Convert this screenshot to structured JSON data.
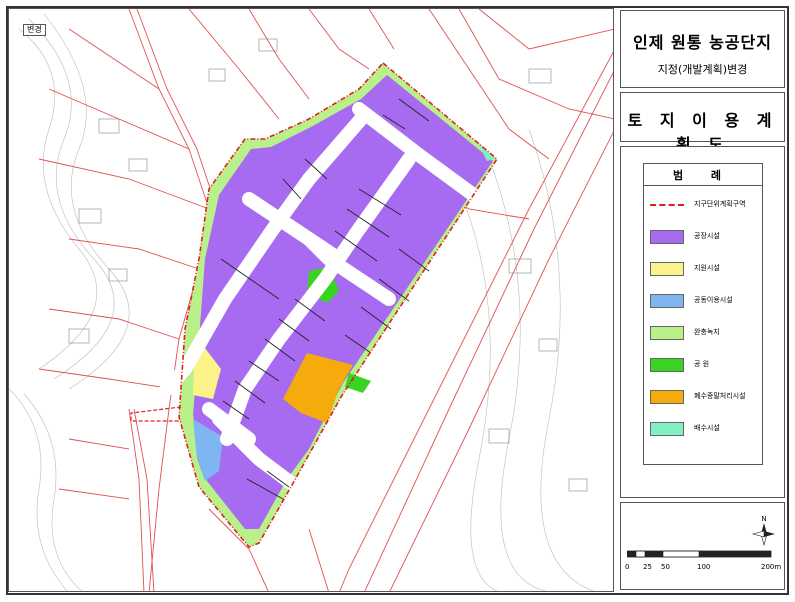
{
  "map": {
    "corner_label": "변경"
  },
  "title": {
    "main": "인제 원통 농공단지",
    "sub": "지정(개발계획)변경"
  },
  "plan": {
    "title": "토 지 이 용 계 획 도"
  },
  "legend": {
    "heading": "범 례",
    "items": [
      {
        "label": "지구단위계획구역",
        "color": "#e02020",
        "style": "dashed-line"
      },
      {
        "label": "공장시설",
        "color": "#a66bf0",
        "style": "fill"
      },
      {
        "label": "지원시설",
        "color": "#fbf28a",
        "style": "fill"
      },
      {
        "label": "공동이용시설",
        "color": "#7fb5f0",
        "style": "fill"
      },
      {
        "label": "완충녹지",
        "color": "#b9f08a",
        "style": "fill"
      },
      {
        "label": "공 원",
        "color": "#39d421",
        "style": "fill"
      },
      {
        "label": "폐수종말처리시설",
        "color": "#f5ab0c",
        "style": "fill"
      },
      {
        "label": "배수시설",
        "color": "#83f0c2",
        "style": "fill"
      }
    ]
  },
  "scale": {
    "north_label": "N",
    "ticks": [
      "0",
      "25",
      "50",
      "100",
      "200m"
    ]
  },
  "colors": {
    "factory": "#a66bf0",
    "support": "#fbf28a",
    "shared": "#7fb5f0",
    "buffer": "#b9f08a",
    "park": "#39d421",
    "wastewater": "#f5ab0c",
    "drainage": "#83f0c2",
    "boundary": "#e02020",
    "cadastral": "#e05050"
  }
}
